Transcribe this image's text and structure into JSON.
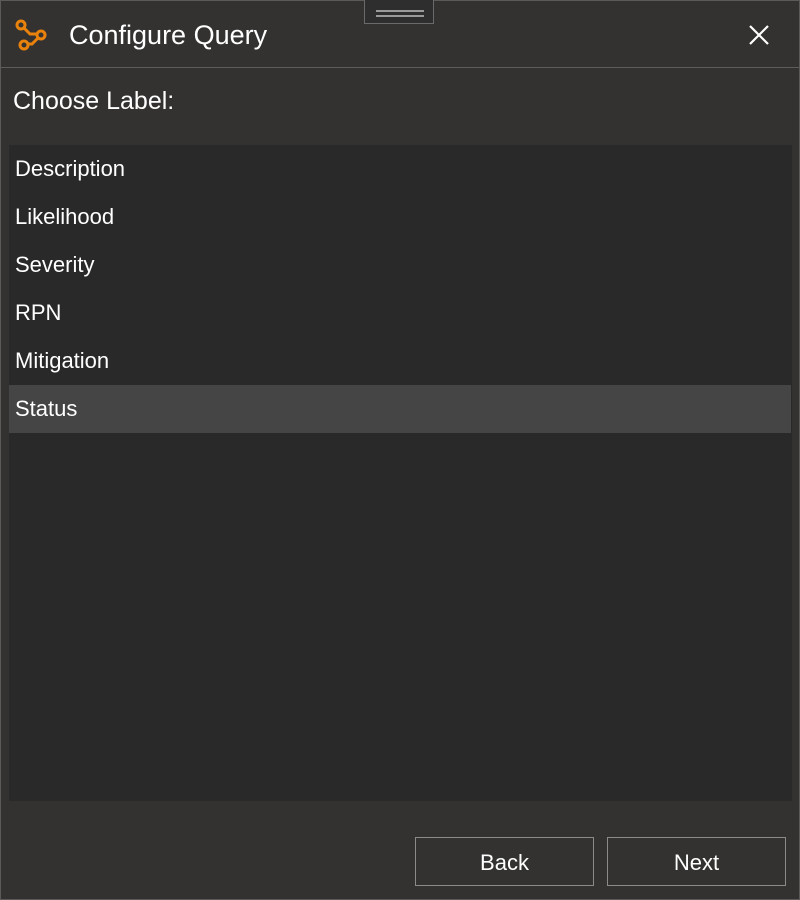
{
  "window": {
    "title": "Configure Query",
    "app_icon": "query-path-icon",
    "close_icon": "close-icon",
    "grip_icon": "drag-grip-icon",
    "accent_color": "#e8820c"
  },
  "main": {
    "section_label": "Choose Label:",
    "items": [
      {
        "label": "Description",
        "selected": false
      },
      {
        "label": "Likelihood",
        "selected": false
      },
      {
        "label": "Severity",
        "selected": false
      },
      {
        "label": "RPN",
        "selected": false
      },
      {
        "label": "Mitigation",
        "selected": false
      },
      {
        "label": "Status",
        "selected": true
      }
    ]
  },
  "footer": {
    "back_label": "Back",
    "next_label": "Next"
  }
}
